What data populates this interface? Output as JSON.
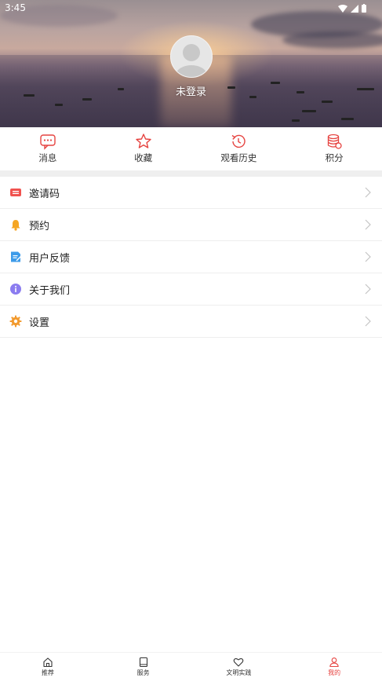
{
  "status_bar": {
    "time": "3:45"
  },
  "profile": {
    "login_status": "未登录"
  },
  "quick_actions": [
    {
      "label": "消息",
      "icon": "message-icon"
    },
    {
      "label": "收藏",
      "icon": "star-icon"
    },
    {
      "label": "观看历史",
      "icon": "history-icon"
    },
    {
      "label": "积分",
      "icon": "points-icon"
    }
  ],
  "menu": [
    {
      "label": "邀请码",
      "icon": "ticket-icon",
      "color": "#f0524f"
    },
    {
      "label": "预约",
      "icon": "bell-icon",
      "color": "#f5a623"
    },
    {
      "label": "用户反馈",
      "icon": "feedback-icon",
      "color": "#3d9be9"
    },
    {
      "label": "关于我们",
      "icon": "info-icon",
      "color": "#8b7cf0"
    },
    {
      "label": "设置",
      "icon": "gear-icon",
      "color": "#f29a2e"
    }
  ],
  "tabs": [
    {
      "label": "推荐",
      "icon": "home-icon",
      "active": false
    },
    {
      "label": "服务",
      "icon": "book-icon",
      "active": false
    },
    {
      "label": "文明实践",
      "icon": "heart-icon",
      "active": false
    },
    {
      "label": "我的",
      "icon": "user-icon",
      "active": true
    }
  ],
  "colors": {
    "accent": "#e64340",
    "divider": "#efefef"
  }
}
